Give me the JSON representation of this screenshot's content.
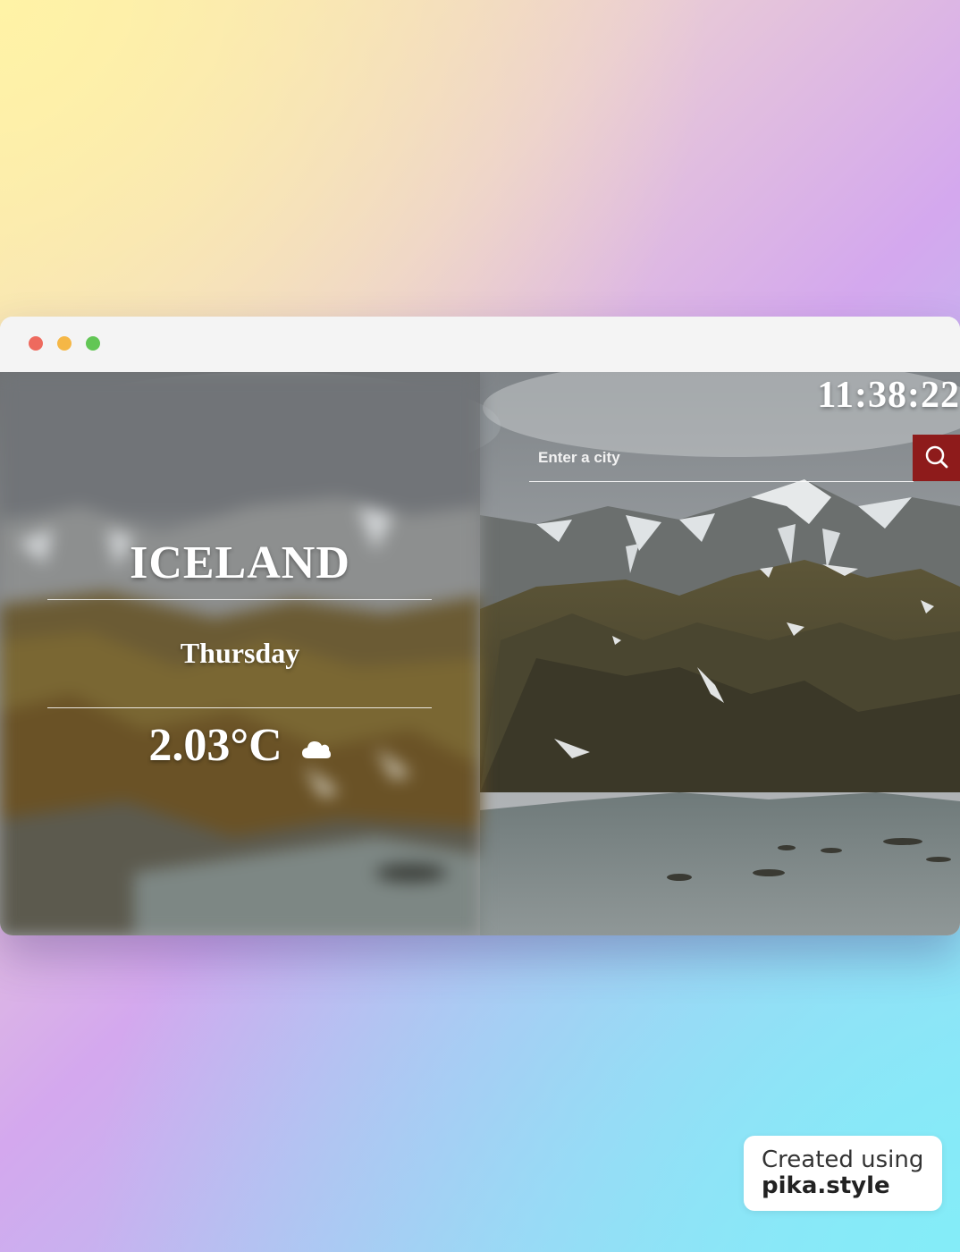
{
  "window": {
    "controls": [
      "close",
      "minimize",
      "maximize"
    ]
  },
  "weather": {
    "time": "11:38:22",
    "country": "ICELAND",
    "day": "Thursday",
    "temperature": "2.03°C",
    "condition_icon": "cloud-icon"
  },
  "search": {
    "placeholder": "Enter a city",
    "value": "",
    "button_icon": "search-icon",
    "button_color": "#8e1b1b"
  },
  "watermark": {
    "line1": "Created using",
    "line2": "pika.style"
  },
  "colors": {
    "close": "#ee6a5e",
    "minimize": "#f5b746",
    "maximize": "#62c655"
  }
}
